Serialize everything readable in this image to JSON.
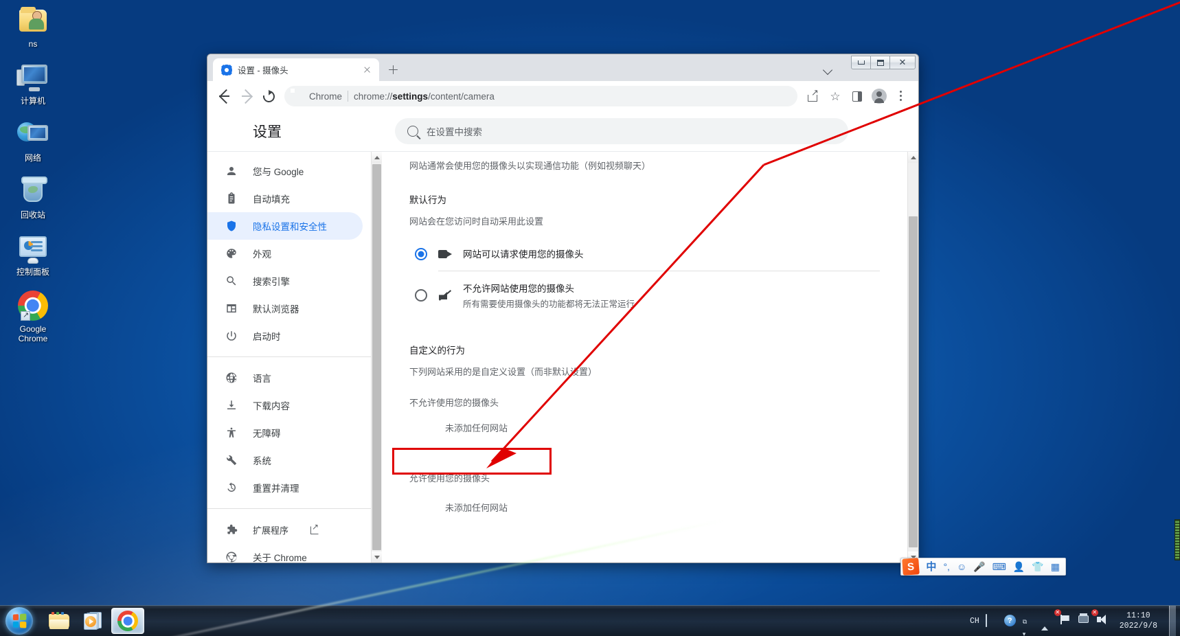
{
  "desktop": {
    "icons": [
      {
        "name": "ns",
        "label": "ns",
        "icon": "folder-user-icon"
      },
      {
        "name": "computer",
        "label": "计算机",
        "icon": "computer-icon"
      },
      {
        "name": "network",
        "label": "网络",
        "icon": "network-icon"
      },
      {
        "name": "recycle-bin",
        "label": "回收站",
        "icon": "recycle-bin-icon"
      },
      {
        "name": "control-panel",
        "label": "控制面板",
        "icon": "control-panel-icon"
      },
      {
        "name": "google-chrome",
        "label": "Google Chrome",
        "icon": "chrome-icon"
      }
    ]
  },
  "browser": {
    "tab": {
      "title": "设置 - 摄像头",
      "favicon": "settings-gear-icon",
      "close_label": "×"
    },
    "new_tab_label": "+",
    "window_controls": {
      "minimize": "–",
      "maximize": "❐",
      "close": "✕"
    },
    "toolbar": {
      "back": "←",
      "forward": "→",
      "reload": "⟳",
      "omnibox": {
        "brand": "Chrome",
        "url_prefix": "chrome://",
        "url_bold": "settings",
        "url_suffix": "/content/camera",
        "full_url": "chrome://settings/content/camera"
      },
      "share": "share-icon",
      "bookmark": "star-icon",
      "side_panel": "side-panel-icon",
      "profile": "avatar-icon",
      "menu": "three-dot-menu-icon"
    }
  },
  "settings": {
    "header": {
      "title": "设置",
      "logo": "chrome-logo-icon"
    },
    "search": {
      "placeholder": "在设置中搜索",
      "icon": "search-icon"
    },
    "sidebar": {
      "group1": [
        {
          "label": "您与 Google",
          "icon": "person-icon",
          "active": false
        },
        {
          "label": "自动填充",
          "icon": "clipboard-icon",
          "active": false
        },
        {
          "label": "隐私设置和安全性",
          "icon": "shield-icon",
          "active": true
        },
        {
          "label": "外观",
          "icon": "palette-icon",
          "active": false
        },
        {
          "label": "搜索引擎",
          "icon": "search-icon",
          "active": false
        },
        {
          "label": "默认浏览器",
          "icon": "browser-window-icon",
          "active": false
        },
        {
          "label": "启动时",
          "icon": "power-icon",
          "active": false
        }
      ],
      "group2": [
        {
          "label": "语言",
          "icon": "globe-icon",
          "active": false
        },
        {
          "label": "下载内容",
          "icon": "download-icon",
          "active": false
        },
        {
          "label": "无障碍",
          "icon": "accessibility-icon",
          "active": false
        },
        {
          "label": "系统",
          "icon": "wrench-icon",
          "active": false
        },
        {
          "label": "重置并清理",
          "icon": "history-restore-icon",
          "active": false
        }
      ],
      "group3": [
        {
          "label": "扩展程序",
          "icon": "puzzle-icon",
          "external": true,
          "external_icon": "external-link-icon",
          "active": false
        },
        {
          "label": "关于 Chrome",
          "icon": "chrome-outline-icon",
          "active": false
        }
      ]
    },
    "camera_page": {
      "description": "网站通常会使用您的摄像头以实现通信功能（例如视频聊天）",
      "default_behavior_title": "默认行为",
      "default_behavior_sub": "网站会在您访问时自动采用此设置",
      "options": [
        {
          "label": "网站可以请求使用您的摄像头",
          "sublabel": "",
          "icon": "camera-icon",
          "selected": true
        },
        {
          "label": "不允许网站使用您的摄像头",
          "sublabel": "所有需要使用摄像头的功能都将无法正常运行",
          "icon": "camera-off-icon",
          "selected": false
        }
      ],
      "custom_behavior_title": "自定义的行为",
      "custom_behavior_sub": "下列网站采用的是自定义设置（而非默认设置）",
      "block_group_label": "不允许使用您的摄像头",
      "block_group_empty": "未添加任何网站",
      "allow_group_label": "允许使用您的摄像头",
      "allow_group_empty": "未添加任何网站"
    }
  },
  "annotations": {
    "highlight_color": "#e00000",
    "rect_target": "允许使用您的摄像头",
    "arrow": "points from upper-right to the highlighted 允许使用您的摄像头 label"
  },
  "taskbar": {
    "start_label": "开始",
    "pinned": [
      {
        "name": "windows-explorer",
        "label": "Windows 资源管理器",
        "icon": "folder-icon"
      },
      {
        "name": "media-player",
        "label": "Windows Media Player",
        "icon": "media-player-icon"
      },
      {
        "name": "google-chrome",
        "label": "Google Chrome",
        "icon": "chrome-icon",
        "active": true
      }
    ],
    "ime": {
      "logo": "S",
      "mode": "中",
      "punct": "°,",
      "items": [
        "smiley-icon",
        "microphone-icon",
        "keyboard-icon",
        "user-icon",
        "skin-icon",
        "toolbox-icon"
      ]
    },
    "tray": {
      "language": "CH",
      "items": [
        "keyboard-icon",
        "help-icon",
        "show-hidden-icon",
        "up-arrow-icon",
        "network-error-icon",
        "network-icon",
        "volume-mute-icon"
      ],
      "clock_time": "11:10",
      "clock_date": "2022/9/8"
    }
  }
}
